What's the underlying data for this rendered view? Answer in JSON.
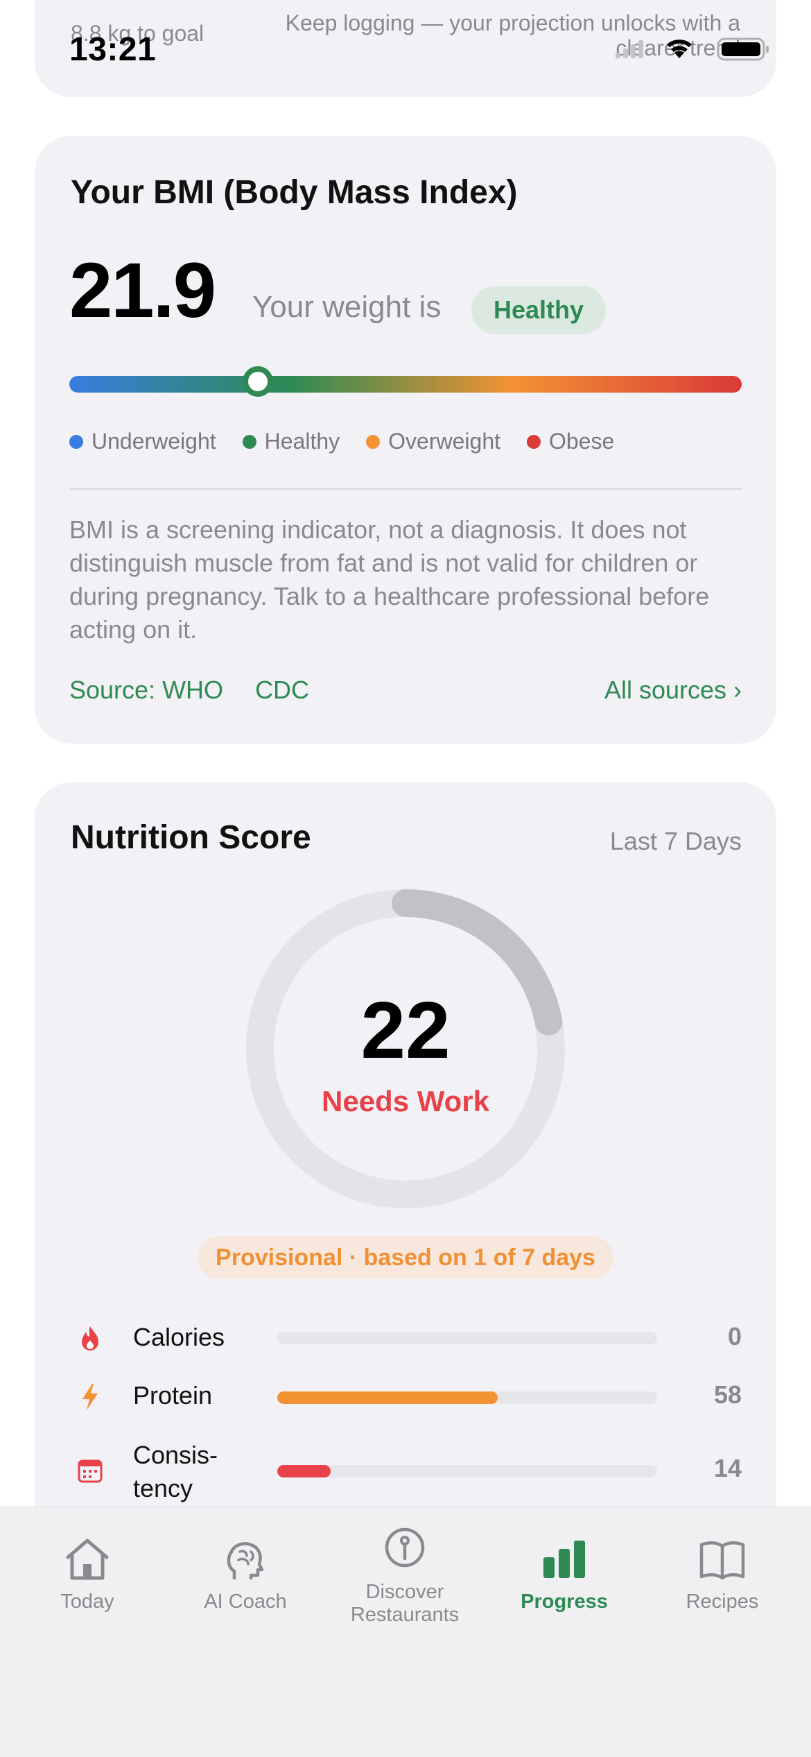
{
  "status_bar": {
    "time": "13:21"
  },
  "top_card": {
    "goal_text": "8.8 kg to goal",
    "projection_text": "Keep logging — your projection unlocks with a clearer trend"
  },
  "bmi": {
    "title": "Your BMI (Body Mass Index)",
    "value": "21.9",
    "weight_label": "Your weight is",
    "status": "Healthy",
    "scale_position": 0.28,
    "legend": [
      {
        "label": "Underweight",
        "color": "#3a7de0"
      },
      {
        "label": "Healthy",
        "color": "#2e8a52"
      },
      {
        "label": "Overweight",
        "color": "#f39233"
      },
      {
        "label": "Obese",
        "color": "#d93a3a"
      }
    ],
    "disclaimer": "BMI is a screening indicator, not a diagnosis. It does not distinguish muscle from fat and is not valid for children or during pregnancy. Talk to a healthcare professional before acting on it.",
    "sources": [
      "Source: WHO",
      "CDC"
    ],
    "all_sources": "All sources ›"
  },
  "nutrition": {
    "title": "Nutrition Score",
    "period": "Last 7 Days",
    "score": "22",
    "score_fraction": 0.22,
    "score_label": "Needs Work",
    "provisional": "Provisional · based on 1 of 7 days",
    "metrics": [
      {
        "label": "Calories",
        "value": "0",
        "fraction": 0.0,
        "color": "#e8414a",
        "icon": "flame-icon"
      },
      {
        "label": "Protein",
        "value": "58",
        "fraction": 0.58,
        "color": "#f39233",
        "icon": "bolt-icon"
      },
      {
        "label": "Consis-\ntency",
        "value": "14",
        "fraction": 0.14,
        "color": "#e8414a",
        "icon": "calendar-icon"
      }
    ]
  },
  "tabs": [
    {
      "label": "Today",
      "icon": "home-icon",
      "active": false
    },
    {
      "label": "AI Coach",
      "icon": "brain-icon",
      "active": false
    },
    {
      "label": "Discover\nRestaurants",
      "icon": "pin-icon",
      "active": false
    },
    {
      "label": "Progress",
      "icon": "bar-chart-icon",
      "active": true
    },
    {
      "label": "Recipes",
      "icon": "book-icon",
      "active": false
    }
  ],
  "colors": {
    "accent": "#2e8a52",
    "warning": "#f39233",
    "danger": "#e8414a"
  }
}
